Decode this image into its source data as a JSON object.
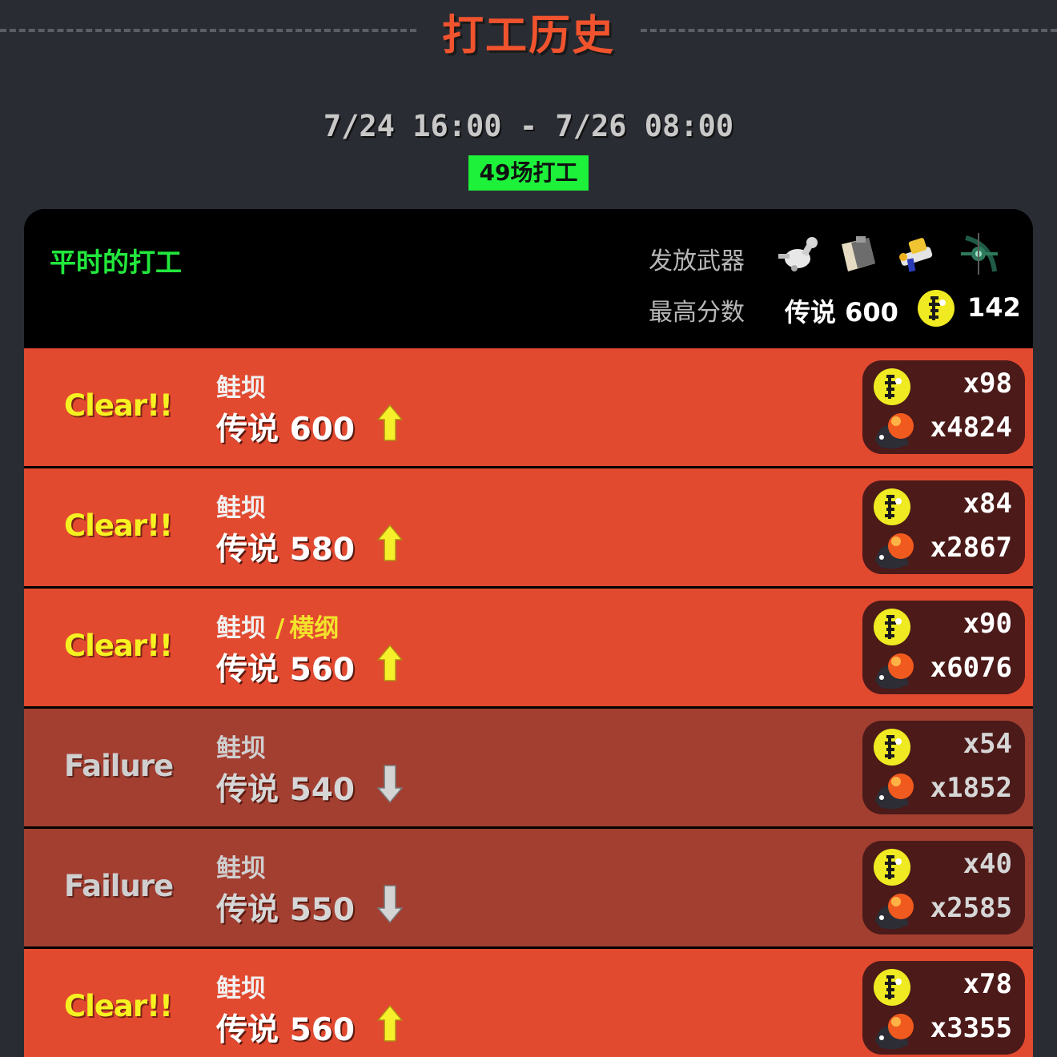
{
  "header": {
    "title": "打工历史"
  },
  "rotation": {
    "period": "7/24 16:00 - 7/26 08:00",
    "shift_count": "49场打工"
  },
  "card": {
    "mode_title": "平时的打工",
    "weapons_label": "发放武器",
    "best_label": "最高分数",
    "weapons": [
      "splatling-icon",
      "tri-stringer-bucket-icon",
      "splattershot-icon",
      "bow-icon"
    ],
    "best_grade": "传说 600",
    "best_golden_eggs": "142"
  },
  "rows": [
    {
      "result": "Clear!!",
      "status": "clear",
      "stage": "鲑坝",
      "boss": "",
      "grade": "传说 600",
      "direction": "up",
      "golden": "x98",
      "power": "x4824"
    },
    {
      "result": "Clear!!",
      "status": "clear",
      "stage": "鲑坝",
      "boss": "",
      "grade": "传说 580",
      "direction": "up",
      "golden": "x84",
      "power": "x2867"
    },
    {
      "result": "Clear!!",
      "status": "clear",
      "stage": "鲑坝",
      "boss": "横纲",
      "grade": "传说 560",
      "direction": "up",
      "golden": "x90",
      "power": "x6076"
    },
    {
      "result": "Failure",
      "status": "fail",
      "stage": "鲑坝",
      "boss": "",
      "grade": "传说 540",
      "direction": "down",
      "golden": "x54",
      "power": "x1852"
    },
    {
      "result": "Failure",
      "status": "fail",
      "stage": "鲑坝",
      "boss": "",
      "grade": "传说 550",
      "direction": "down",
      "golden": "x40",
      "power": "x2585"
    },
    {
      "result": "Clear!!",
      "status": "clear",
      "stage": "鲑坝",
      "boss": "",
      "grade": "传说 560",
      "direction": "up",
      "golden": "x78",
      "power": "x3355"
    }
  ],
  "colors": {
    "clear_row": "#e24a30",
    "fail_row": "#a33f31",
    "clear_text": "#f6f221",
    "accent_green": "#1df13a"
  }
}
